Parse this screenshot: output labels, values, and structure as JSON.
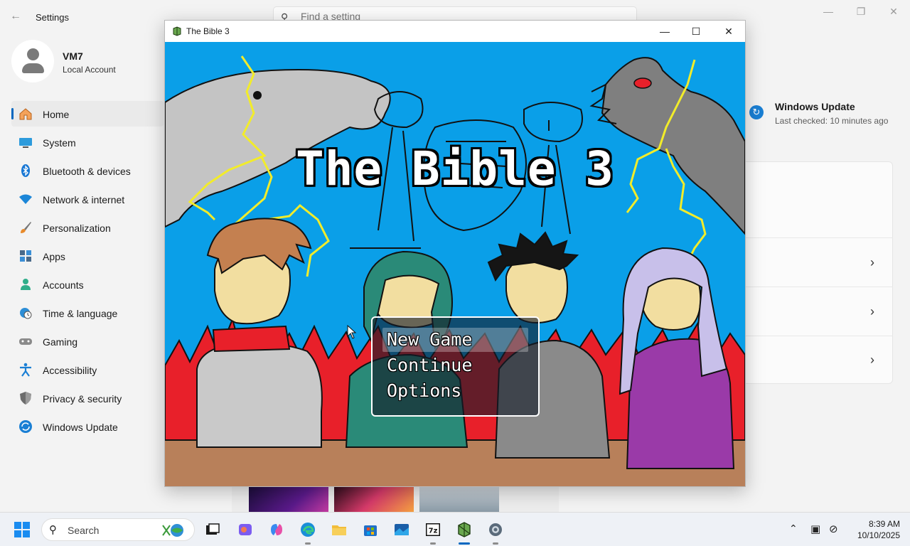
{
  "settings": {
    "title": "Settings",
    "search_placeholder": "Find a setting",
    "profile": {
      "name": "VM7",
      "account_type": "Local Account"
    },
    "nav": [
      {
        "label": "Home",
        "icon": "home-icon",
        "active": true
      },
      {
        "label": "System",
        "icon": "system-icon"
      },
      {
        "label": "Bluetooth & devices",
        "icon": "bluetooth-icon"
      },
      {
        "label": "Network & internet",
        "icon": "wifi-icon"
      },
      {
        "label": "Personalization",
        "icon": "brush-icon"
      },
      {
        "label": "Apps",
        "icon": "apps-icon"
      },
      {
        "label": "Accounts",
        "icon": "accounts-icon"
      },
      {
        "label": "Time & language",
        "icon": "clock-globe-icon"
      },
      {
        "label": "Gaming",
        "icon": "gamepad-icon"
      },
      {
        "label": "Accessibility",
        "icon": "accessibility-icon"
      },
      {
        "label": "Privacy & security",
        "icon": "shield-icon"
      },
      {
        "label": "Windows Update",
        "icon": "update-icon"
      }
    ],
    "windows_update": {
      "title": "Windows Update",
      "last_checked": "Last checked: 10 minutes ago"
    }
  },
  "game_window": {
    "title": "The Bible 3",
    "game_title": "The Bible 3",
    "menu": [
      {
        "label": "New Game",
        "selected": true
      },
      {
        "label": "Continue"
      },
      {
        "label": "Options"
      }
    ]
  },
  "taskbar": {
    "search_label": "Search",
    "time": "8:39 AM",
    "date": "10/10/2025"
  },
  "colors": {
    "sky": "#0a9fe8",
    "accent": "#0067c0",
    "fire": "#e8202a",
    "ground": "#b8805a"
  }
}
